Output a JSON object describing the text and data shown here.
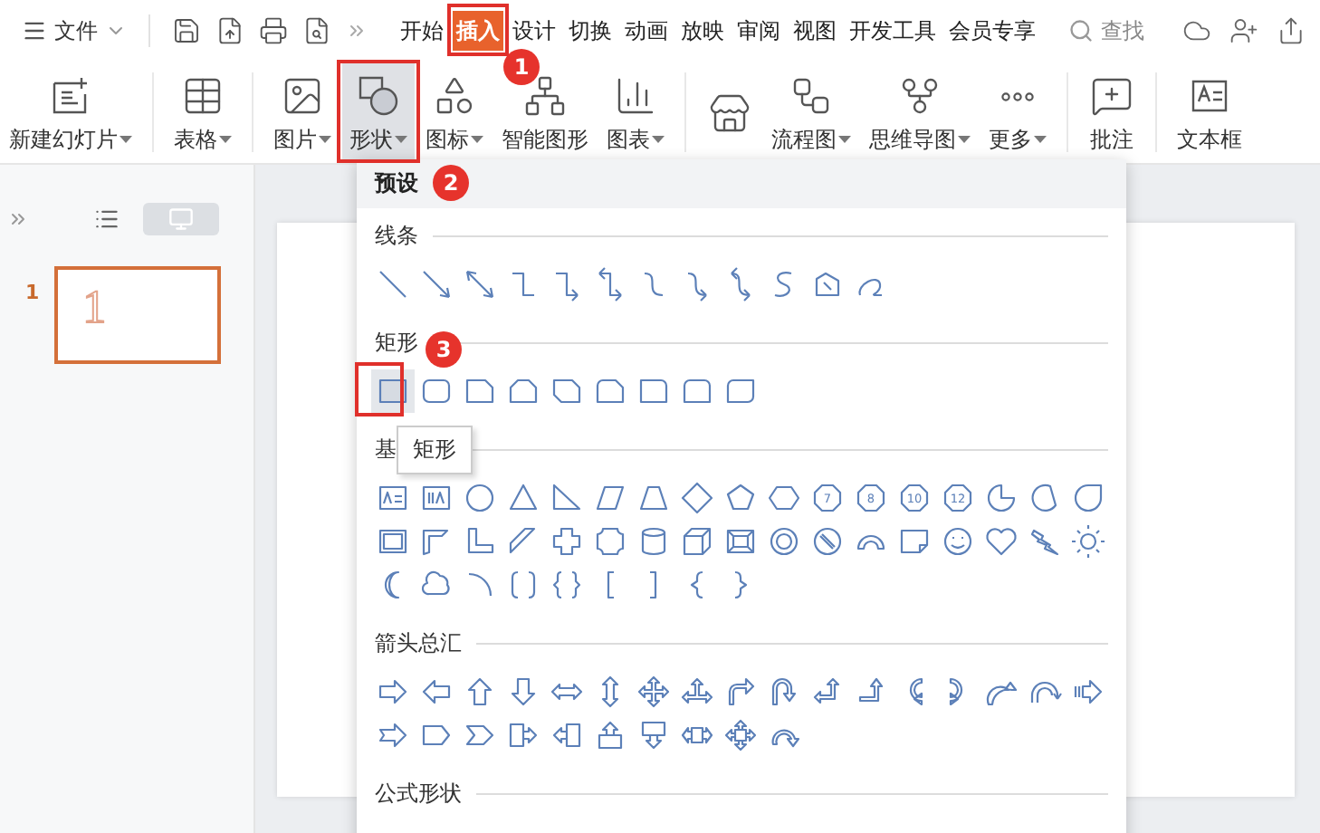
{
  "menu_bar": {
    "file_menu": "文件",
    "tabs": [
      {
        "label": "开始",
        "selected": false
      },
      {
        "label": "插入",
        "selected": true
      },
      {
        "label": "设计",
        "selected": false
      },
      {
        "label": "切换",
        "selected": false
      },
      {
        "label": "动画",
        "selected": false
      },
      {
        "label": "放映",
        "selected": false
      },
      {
        "label": "审阅",
        "selected": false
      },
      {
        "label": "视图",
        "selected": false
      },
      {
        "label": "开发工具",
        "selected": false
      },
      {
        "label": "会员专享",
        "selected": false
      }
    ],
    "search": {
      "placeholder": "查找"
    }
  },
  "ribbon": {
    "groups": [
      [
        {
          "kind": "new-slide",
          "label": "新建幻灯片",
          "dropdown": true,
          "selected": false
        }
      ],
      [
        {
          "kind": "table",
          "label": "表格",
          "dropdown": true,
          "selected": false
        }
      ],
      [
        {
          "kind": "picture",
          "label": "图片",
          "dropdown": true,
          "selected": false
        },
        {
          "kind": "shape",
          "label": "形状",
          "dropdown": true,
          "selected": true
        },
        {
          "kind": "icon-set",
          "label": "图标",
          "dropdown": true,
          "selected": false
        },
        {
          "kind": "smart-graphic",
          "label": "智能图形",
          "dropdown": false,
          "selected": false
        },
        {
          "kind": "chart",
          "label": "图表",
          "dropdown": true,
          "selected": false
        }
      ],
      [
        {
          "kind": "store",
          "dropdown": false,
          "selected": false
        },
        {
          "kind": "flowchart",
          "label": "流程图",
          "dropdown": true,
          "selected": false
        },
        {
          "kind": "mindmap",
          "label": "思维导图",
          "dropdown": true,
          "selected": false
        },
        {
          "kind": "more",
          "label": "更多",
          "dropdown": true,
          "selected": false
        }
      ],
      [
        {
          "kind": "comment",
          "label": "批注",
          "dropdown": false,
          "selected": false
        }
      ],
      [
        {
          "kind": "textbox",
          "label": "文本框",
          "dropdown": false,
          "selected": false
        }
      ]
    ]
  },
  "slide_panel": {
    "view_toggle": [
      {
        "kind": "outline",
        "selected": false
      },
      {
        "kind": "thumbnails",
        "selected": true
      }
    ],
    "slides": [
      {
        "number": "1",
        "content": "1",
        "selected": true
      }
    ]
  },
  "shape_menu": {
    "header": "预设",
    "tooltip": "矩形",
    "sections": [
      {
        "title": "线条",
        "shapes": [
          {
            "kind": "line",
            "selected": false
          },
          {
            "kind": "arrow",
            "selected": false
          },
          {
            "kind": "double-arrow",
            "selected": false
          },
          {
            "kind": "elbow",
            "selected": false
          },
          {
            "kind": "elbow-arrow",
            "selected": false
          },
          {
            "kind": "elbow-double",
            "selected": false
          },
          {
            "kind": "curve",
            "selected": false
          },
          {
            "kind": "curve-arrow",
            "selected": false
          },
          {
            "kind": "curve-double",
            "selected": false
          },
          {
            "kind": "scribble",
            "selected": false
          },
          {
            "kind": "freeform",
            "selected": false
          },
          {
            "kind": "freehand",
            "selected": false
          }
        ]
      },
      {
        "title": "矩形",
        "shapes": [
          {
            "kind": "rect",
            "selected": true
          },
          {
            "kind": "round-rect",
            "selected": false
          },
          {
            "kind": "snip-rect",
            "selected": false
          },
          {
            "kind": "snip-top",
            "selected": false
          },
          {
            "kind": "snip-diag",
            "selected": false
          },
          {
            "kind": "snip-round",
            "selected": false
          },
          {
            "kind": "round-single",
            "selected": false
          },
          {
            "kind": "round-top",
            "selected": false
          },
          {
            "kind": "round-diag",
            "selected": false
          }
        ]
      },
      {
        "title": "基",
        "shapes": [
          {
            "kind": "textbox",
            "selected": false
          },
          {
            "kind": "vtextbox",
            "selected": false
          },
          {
            "kind": "ellipse",
            "selected": false
          },
          {
            "kind": "triangle",
            "selected": false
          },
          {
            "kind": "right-triangle",
            "selected": false
          },
          {
            "kind": "parallelogram",
            "selected": false
          },
          {
            "kind": "trapezoid",
            "selected": false
          },
          {
            "kind": "diamond",
            "selected": false
          },
          {
            "kind": "pentagon",
            "selected": false
          },
          {
            "kind": "hexagon",
            "selected": false
          },
          {
            "kind": "polygon",
            "label": "7",
            "selected": false
          },
          {
            "kind": "polygon",
            "label": "8",
            "selected": false
          },
          {
            "kind": "polygon",
            "label": "10",
            "selected": false
          },
          {
            "kind": "polygon",
            "label": "12",
            "selected": false
          },
          {
            "kind": "pie",
            "selected": false
          },
          {
            "kind": "chord",
            "selected": false
          },
          {
            "kind": "teardrop",
            "selected": false
          },
          {
            "kind": "frame",
            "selected": false
          },
          {
            "kind": "half-frame",
            "selected": false
          },
          {
            "kind": "l-shape",
            "selected": false
          },
          {
            "kind": "diag-stripe",
            "selected": false
          },
          {
            "kind": "cross",
            "selected": false
          },
          {
            "kind": "plaque",
            "selected": false
          },
          {
            "kind": "can",
            "selected": false
          },
          {
            "kind": "cube",
            "selected": false
          },
          {
            "kind": "bevel",
            "selected": false
          },
          {
            "kind": "donut",
            "selected": false
          },
          {
            "kind": "no-symbol",
            "selected": false
          },
          {
            "kind": "arc-block",
            "selected": false
          },
          {
            "kind": "folded",
            "selected": false
          },
          {
            "kind": "smiley",
            "selected": false
          },
          {
            "kind": "heart",
            "selected": false
          },
          {
            "kind": "lightning",
            "selected": false
          },
          {
            "kind": "sun",
            "selected": false
          },
          {
            "kind": "moon",
            "selected": false
          },
          {
            "kind": "cloud",
            "selected": false
          },
          {
            "kind": "arc",
            "selected": false
          },
          {
            "kind": "bracket-pair",
            "selected": false
          },
          {
            "kind": "brace-pair",
            "selected": false
          },
          {
            "kind": "left-bracket",
            "selected": false
          },
          {
            "kind": "right-bracket",
            "selected": false
          },
          {
            "kind": "left-brace",
            "selected": false
          },
          {
            "kind": "right-brace",
            "selected": false
          }
        ]
      },
      {
        "title": "箭头总汇",
        "shapes": [
          {
            "kind": "right",
            "selected": false
          },
          {
            "kind": "left",
            "selected": false
          },
          {
            "kind": "up",
            "selected": false
          },
          {
            "kind": "down",
            "selected": false
          },
          {
            "kind": "left-right",
            "selected": false
          },
          {
            "kind": "up-down",
            "selected": false
          },
          {
            "kind": "quad",
            "selected": false
          },
          {
            "kind": "left-right-up",
            "selected": false
          },
          {
            "kind": "bent",
            "selected": false
          },
          {
            "kind": "u-turn",
            "selected": false
          },
          {
            "kind": "left-up",
            "selected": false
          },
          {
            "kind": "bent-up",
            "selected": false
          },
          {
            "kind": "curved-right",
            "selected": false
          },
          {
            "kind": "curved-left",
            "selected": false
          },
          {
            "kind": "curved-up",
            "selected": false
          },
          {
            "kind": "curved-down",
            "selected": false
          },
          {
            "kind": "striped-right",
            "selected": false
          },
          {
            "kind": "notched-right",
            "selected": false
          },
          {
            "kind": "pentagon-arrow",
            "selected": false
          },
          {
            "kind": "chevron",
            "selected": false
          },
          {
            "kind": "right-callout",
            "selected": false
          },
          {
            "kind": "left-callout",
            "selected": false
          },
          {
            "kind": "up-callout",
            "selected": false
          },
          {
            "kind": "down-callout",
            "selected": false
          },
          {
            "kind": "left-right-callout",
            "selected": false
          },
          {
            "kind": "quad-callout",
            "selected": false
          },
          {
            "kind": "circular",
            "selected": false
          }
        ]
      },
      {
        "title": "公式形状"
      }
    ]
  },
  "annotations": [
    {
      "label": "1"
    },
    {
      "label": "2"
    },
    {
      "label": "3"
    }
  ]
}
